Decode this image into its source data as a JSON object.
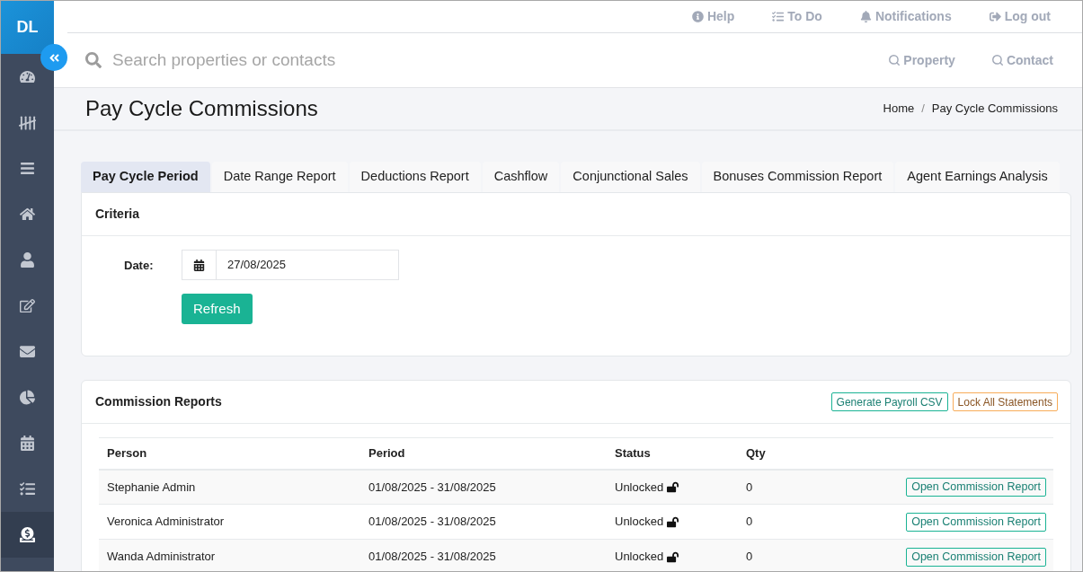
{
  "sidebar": {
    "logo": "DL",
    "items": [
      {
        "selected": false
      },
      {
        "selected": false
      },
      {
        "selected": false
      },
      {
        "selected": false
      },
      {
        "selected": false
      },
      {
        "selected": false
      },
      {
        "selected": false
      },
      {
        "selected": false
      },
      {
        "selected": false
      },
      {
        "selected": false
      },
      {
        "selected": true
      }
    ]
  },
  "top_links": [
    {
      "label": "Help"
    },
    {
      "label": "To Do"
    },
    {
      "label": "Notifications"
    },
    {
      "label": "Log out"
    }
  ],
  "search": {
    "placeholder": "Search properties or contacts",
    "scopes": [
      {
        "label": "Property"
      },
      {
        "label": "Contact"
      }
    ]
  },
  "page_header": {
    "title": "Pay Cycle Commissions",
    "breadcrumb": [
      {
        "label": "Home"
      },
      {
        "label": "Pay Cycle Commissions"
      }
    ],
    "separator": "/"
  },
  "tabs": [
    {
      "label": "Pay Cycle Period",
      "selected": true
    },
    {
      "label": "Date Range Report",
      "selected": false
    },
    {
      "label": "Deductions Report",
      "selected": false
    },
    {
      "label": "Cashflow",
      "selected": false
    },
    {
      "label": "Conjunctional Sales",
      "selected": false
    },
    {
      "label": "Bonuses Commission Report",
      "selected": false
    },
    {
      "label": "Agent Earnings Analysis",
      "selected": false
    }
  ],
  "criteria": {
    "title": "Criteria",
    "date_label": "Date:",
    "date_value": "27/08/2025",
    "refresh_button": "Refresh"
  },
  "commission_reports": {
    "title": "Commission Reports",
    "buttons": [
      {
        "label": "Generate Payroll CSV",
        "kind": "primary"
      },
      {
        "label": "Lock All Statements",
        "kind": "warning"
      }
    ],
    "table": {
      "columns": [
        "Person",
        "Period",
        "Status",
        "Qty"
      ],
      "rows": [
        {
          "person": "Stephanie Admin",
          "period": "01/08/2025 - 31/08/2025",
          "status": "Unlocked",
          "locked": false,
          "qty": "0",
          "action": "Open Commission Report"
        },
        {
          "person": "Veronica Administrator",
          "period": "01/08/2025 - 31/08/2025",
          "status": "Unlocked",
          "locked": false,
          "qty": "0",
          "action": "Open Commission Report"
        },
        {
          "person": "Wanda Administrator",
          "period": "01/08/2025 - 31/08/2025",
          "status": "Unlocked",
          "locked": false,
          "qty": "0",
          "action": "Open Commission Report"
        }
      ]
    }
  }
}
